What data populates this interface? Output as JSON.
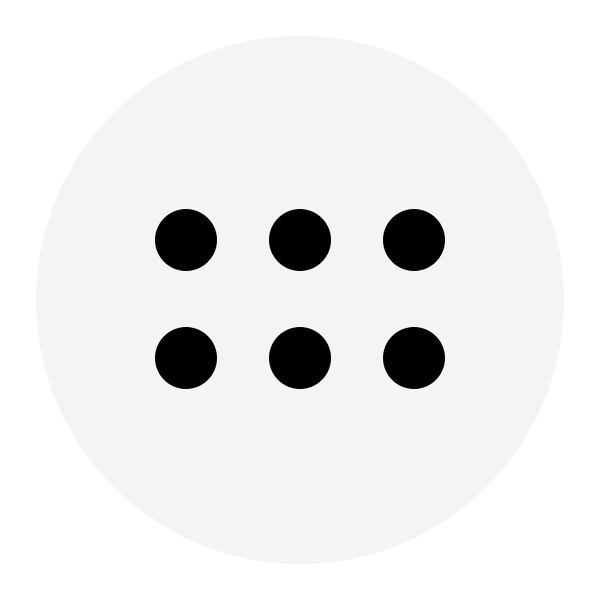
{
  "button": {
    "icon": "apps-grid-icon",
    "background_color": "#f4f4f4",
    "icon_color": "#000000",
    "dot_grid": {
      "rows": 2,
      "columns": 3
    }
  }
}
